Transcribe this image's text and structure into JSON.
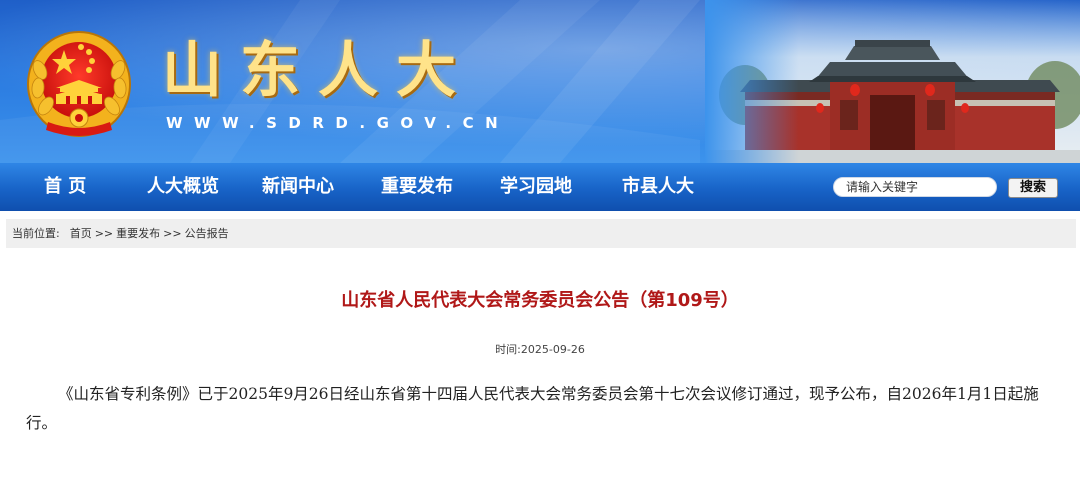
{
  "header": {
    "site_title": "山东人大",
    "site_url": "WWW.SDRD.GOV.CN"
  },
  "nav": {
    "items": [
      {
        "label": "首 页"
      },
      {
        "label": "人大概览"
      },
      {
        "label": "新闻中心"
      },
      {
        "label": "重要发布"
      },
      {
        "label": "学习园地"
      },
      {
        "label": "市县人大"
      }
    ],
    "search_placeholder": "请输入关键字",
    "search_button": "搜索"
  },
  "breadcrumb": {
    "label": "当前位置:",
    "items": [
      "首页",
      "重要发布",
      "公告报告"
    ],
    "separator": ">>"
  },
  "article": {
    "title": "山东省人民代表大会常务委员会公告（第109号）",
    "time_label": "时间:",
    "time": "2025-09-26",
    "body": "《山东省专利条例》已于2025年9月26日经山东省第十四届人民代表大会常务委员会第十七次会议修订通过，现予公布，自2026年1月1日起施行。"
  },
  "colors": {
    "banner_blue": "#2a7ae0",
    "nav_blue": "#1863c7",
    "title_gold": "#ffe38a",
    "article_title_red": "#b01818"
  }
}
